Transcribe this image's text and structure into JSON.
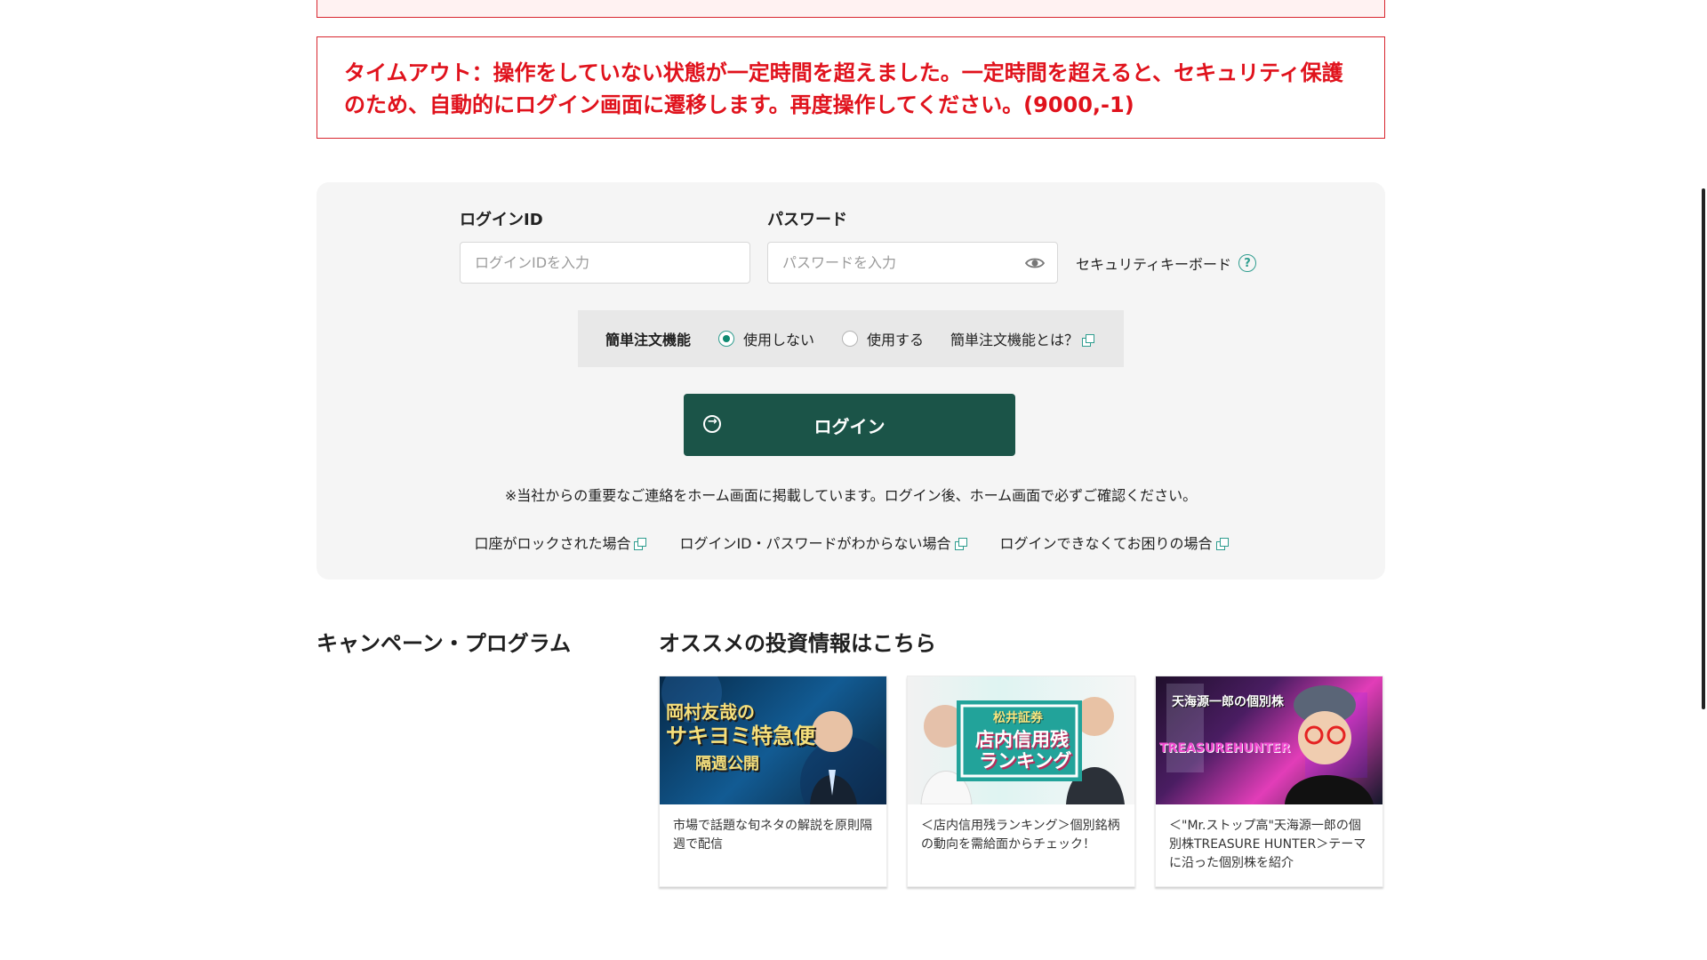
{
  "error": {
    "message": "タイムアウト：操作をしていない状態が一定時間を超えました。一定時間を超えると、セキュリティ保護のため、自動的にログイン画面に遷移します。再度操作してください。(9000,-1)"
  },
  "login": {
    "login_id_label": "ログインID",
    "login_id_placeholder": "ログインIDを入力",
    "login_id_value": "",
    "password_label": "パスワード",
    "password_placeholder": "パスワードを入力",
    "password_value": "",
    "security_keyboard": "セキュリティキーボード",
    "help_mark": "?"
  },
  "simple_order": {
    "label": "簡単注文機能",
    "options": [
      {
        "label": "使用しない",
        "selected": true
      },
      {
        "label": "使用する",
        "selected": false
      }
    ],
    "about": "簡単注文機能とは？"
  },
  "login_button": {
    "label": "ログイン"
  },
  "notice": "※当社からの重要なご連絡をホーム画面に掲載しています。ログイン後、ホーム画面で必ずご確認ください。",
  "help_links": [
    "口座がロックされた場合",
    "ログインID・パスワードがわからない場合",
    "ログインできなくてお困りの場合"
  ],
  "campaign": {
    "title": "キャンペーン・プログラム"
  },
  "recommendations": {
    "title": "オススメの投資情報はこちら",
    "cards": [
      {
        "image_lines": [
          "岡村友哉の",
          "サキヨミ特急便",
          "隔週公開"
        ],
        "text": "市場で話題な旬ネタの解説を原則隔週で配信"
      },
      {
        "image_lines": [
          "松井証券",
          "店内信用残",
          "ランキング"
        ],
        "text": "＜店内信用残ランキング＞個別銘柄の動向を需給面からチェック！"
      },
      {
        "image_lines": [
          "天海源一郎の個別株",
          "TREASUREHUNTER"
        ],
        "text": "＜\"Mr.ストップ高\"天海源一郎の個別株TREASURE HUNTER＞テーマに沿った個別株を紹介"
      }
    ]
  },
  "colors": {
    "error_red": "#e0121c",
    "primary_green": "#1b5448",
    "accent_teal": "#2f9d8f"
  },
  "icons": {
    "eye": "eye-icon",
    "help": "help-icon",
    "external_link": "external-link-icon",
    "login": "login-icon"
  }
}
